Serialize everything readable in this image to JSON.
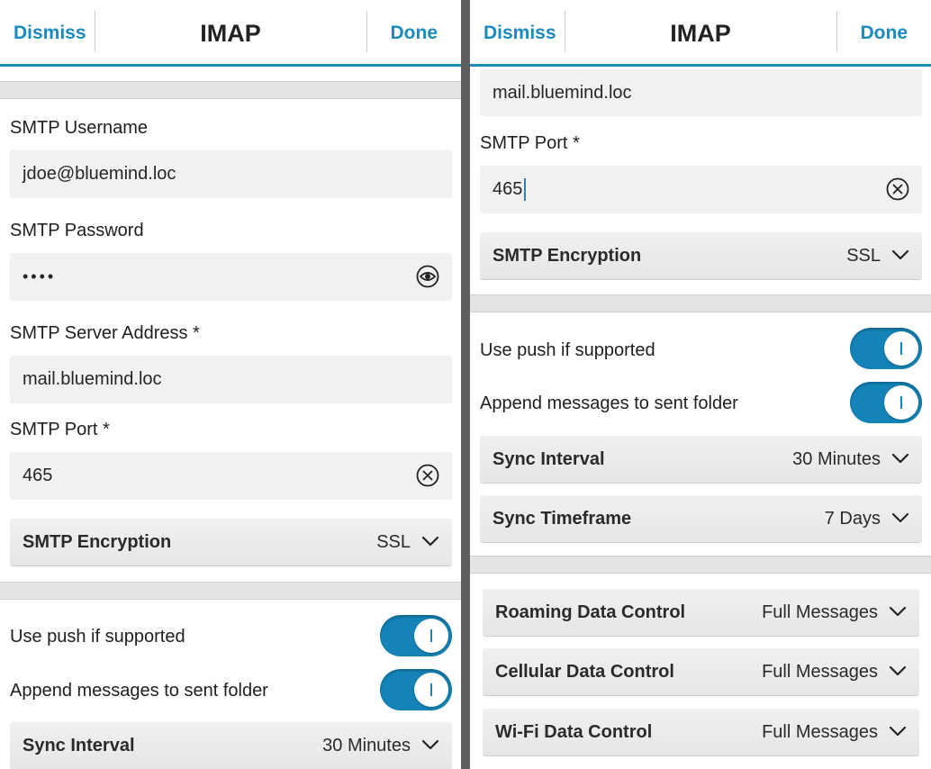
{
  "titlebar": {
    "dismiss_label": "Dismiss",
    "title": "IMAP",
    "done_label": "Done"
  },
  "left": {
    "smtp_username": {
      "label": "SMTP Username",
      "value": "jdoe@bluemind.loc"
    },
    "smtp_password": {
      "label": "SMTP Password",
      "value": "••••"
    },
    "smtp_server": {
      "label": "SMTP Server Address *",
      "value": "mail.bluemind.loc"
    },
    "smtp_port": {
      "label": "SMTP Port *",
      "value": "465"
    },
    "smtp_encryption": {
      "label": "SMTP Encryption",
      "value": "SSL"
    },
    "use_push": {
      "label": "Use push if supported",
      "on": true
    },
    "append_sent": {
      "label": "Append messages to sent folder",
      "on": true
    },
    "sync_interval": {
      "label": "Sync Interval",
      "value": "30 Minutes"
    }
  },
  "right": {
    "smtp_server_value": "mail.bluemind.loc",
    "smtp_port": {
      "label": "SMTP Port *",
      "value": "465"
    },
    "smtp_encryption": {
      "label": "SMTP Encryption",
      "value": "SSL"
    },
    "use_push": {
      "label": "Use push if supported",
      "on": true
    },
    "append_sent": {
      "label": "Append messages to sent folder",
      "on": true
    },
    "sync_interval": {
      "label": "Sync Interval",
      "value": "30 Minutes"
    },
    "sync_timeframe": {
      "label": "Sync Timeframe",
      "value": "7 Days"
    },
    "roaming_data": {
      "label": "Roaming Data Control",
      "value": "Full Messages"
    },
    "cellular_data": {
      "label": "Cellular Data Control",
      "value": "Full Messages"
    },
    "wifi_data": {
      "label": "Wi-Fi Data Control",
      "value": "Full Messages"
    }
  },
  "icons": {
    "clear": "clear-circle-x-icon",
    "eye": "eye-icon",
    "chevron": "chevron-down-icon"
  },
  "colors": {
    "accent": "#1a8bbf",
    "toggle_on": "#1484b8",
    "divider": "#5f5f5f"
  }
}
